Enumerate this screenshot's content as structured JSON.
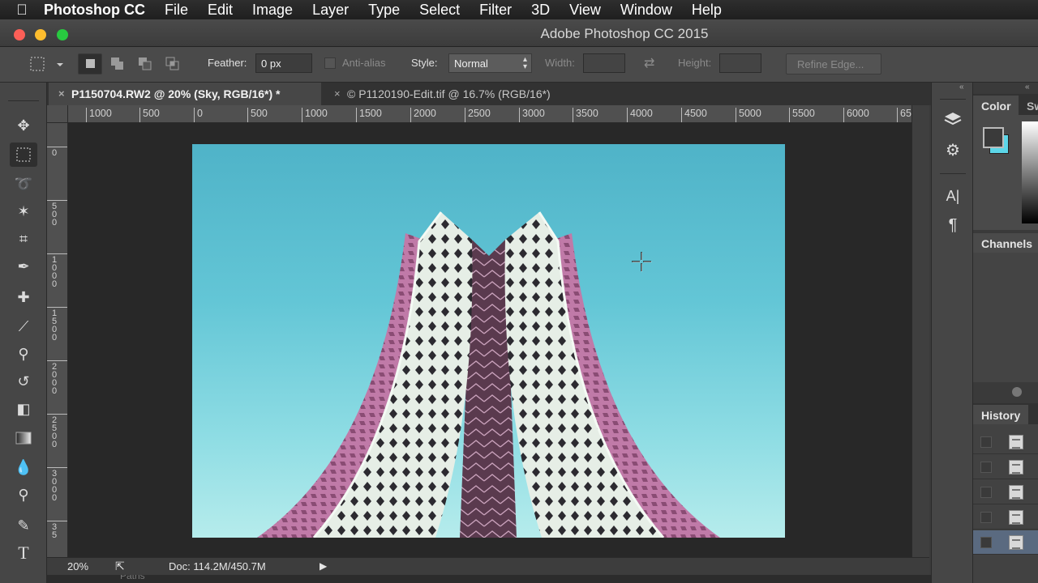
{
  "menubar": {
    "app_name": "Photoshop CC",
    "items": [
      "File",
      "Edit",
      "Image",
      "Layer",
      "Type",
      "Select",
      "Filter",
      "3D",
      "View",
      "Window",
      "Help"
    ]
  },
  "window": {
    "title": "Adobe Photoshop CC 2015"
  },
  "options": {
    "feather_label": "Feather:",
    "feather_value": "0 px",
    "antialias_label": "Anti-alias",
    "style_label": "Style:",
    "style_value": "Normal",
    "width_label": "Width:",
    "height_label": "Height:",
    "refine_edge_label": "Refine Edge..."
  },
  "tabs": [
    {
      "label": "P1150704.RW2 @ 20% (Sky, RGB/16*) *",
      "active": true
    },
    {
      "label": "© P1120190-Edit.tif @ 16.7% (RGB/16*)",
      "active": false
    }
  ],
  "ruler_top": [
    "1000",
    "500",
    "0",
    "500",
    "1000",
    "1500",
    "2000",
    "2500",
    "3000",
    "3500",
    "4000",
    "4500",
    "5000",
    "5500",
    "6000",
    "65"
  ],
  "ruler_left": [
    "0",
    "500",
    "1000",
    "1500",
    "2000",
    "2500",
    "3000",
    "35"
  ],
  "status": {
    "zoom": "20%",
    "doc": "Doc: 114.2M/450.7M"
  },
  "bottom_panel": {
    "label": "Paths"
  },
  "panels": {
    "color_tab": "Color",
    "swatches_tab": "Sw",
    "channels_tab": "Channels",
    "history_tab": "History"
  },
  "tools": [
    "move-tool",
    "marquee-tool",
    "lasso-tool",
    "magic-wand-tool",
    "crop-tool",
    "eyedropper-tool",
    "healing-brush-tool",
    "brush-tool",
    "clone-stamp-tool",
    "history-brush-tool",
    "eraser-tool",
    "gradient-tool",
    "blur-tool",
    "dodge-tool",
    "pen-tool",
    "type-tool"
  ],
  "colors": {
    "sky_top": "#4fb3c8",
    "sky_bottom": "#b6ecec",
    "building_pink": "#c07aa8",
    "building_white": "#e6eee6",
    "building_shadow": "#5a3a4e"
  }
}
